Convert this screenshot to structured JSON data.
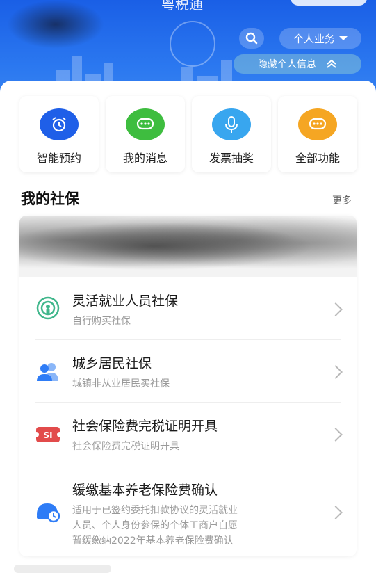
{
  "header": {
    "title_partial": "粤税通",
    "personal_business_label": "个人业务",
    "hide_info_label": "隐藏个人信息"
  },
  "quick_actions": [
    {
      "label": "智能预约",
      "icon": "alarm-clock-icon",
      "color": "#1f5fe8"
    },
    {
      "label": "我的消息",
      "icon": "chat-bubble-icon",
      "color": "#3ebd3f"
    },
    {
      "label": "发票抽奖",
      "icon": "microphone-icon",
      "color": "#38a6ef"
    },
    {
      "label": "全部功能",
      "icon": "more-dots-icon",
      "color": "#f5a623"
    }
  ],
  "section": {
    "title": "我的社保",
    "more_label": "更多"
  },
  "services": [
    {
      "title": "灵活就业人员社保",
      "desc": "自行购买社保",
      "icon": "wireless-person-icon",
      "color": "#3fb68b"
    },
    {
      "title": "城乡居民社保",
      "desc": "城镇非从业居民买社保",
      "icon": "people-icon",
      "color": "#2e7cf6"
    },
    {
      "title": "社会保险费完税证明开具",
      "desc": "社会保险费完税证明开具",
      "icon": "social-security-certificate-icon",
      "color": "#e24b4b"
    },
    {
      "title": "缓缴基本养老保险费确认",
      "desc_lines": [
        "适用于已签约委托扣款协议的灵活就业",
        "人员、个人身份参保的个体工商户自愿",
        "暂缓缴纳2022年基本养老保险费确认"
      ],
      "icon": "defer-payment-icon",
      "color": "#2e7cf6"
    }
  ]
}
